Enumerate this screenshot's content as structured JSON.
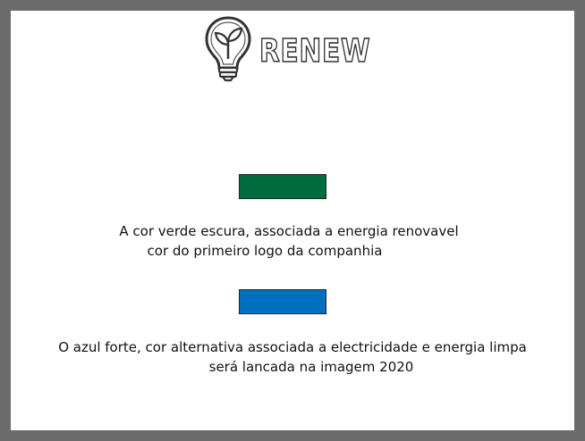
{
  "logo": {
    "wordmark": "RENEW",
    "icon": "lightbulb-leaf-icon"
  },
  "colors": {
    "frame": "#6b6b6b",
    "dark_green": "#006b3c",
    "strong_blue": "#0070c0"
  },
  "green_section": {
    "line1": "A cor verde escura, associada a energia renovavel",
    "line2": "cor do primeiro logo da companhia"
  },
  "blue_section": {
    "line1": "O azul forte, cor alternativa associada a electricidade e energia limpa",
    "line2": "será lancada na imagem 2020"
  }
}
